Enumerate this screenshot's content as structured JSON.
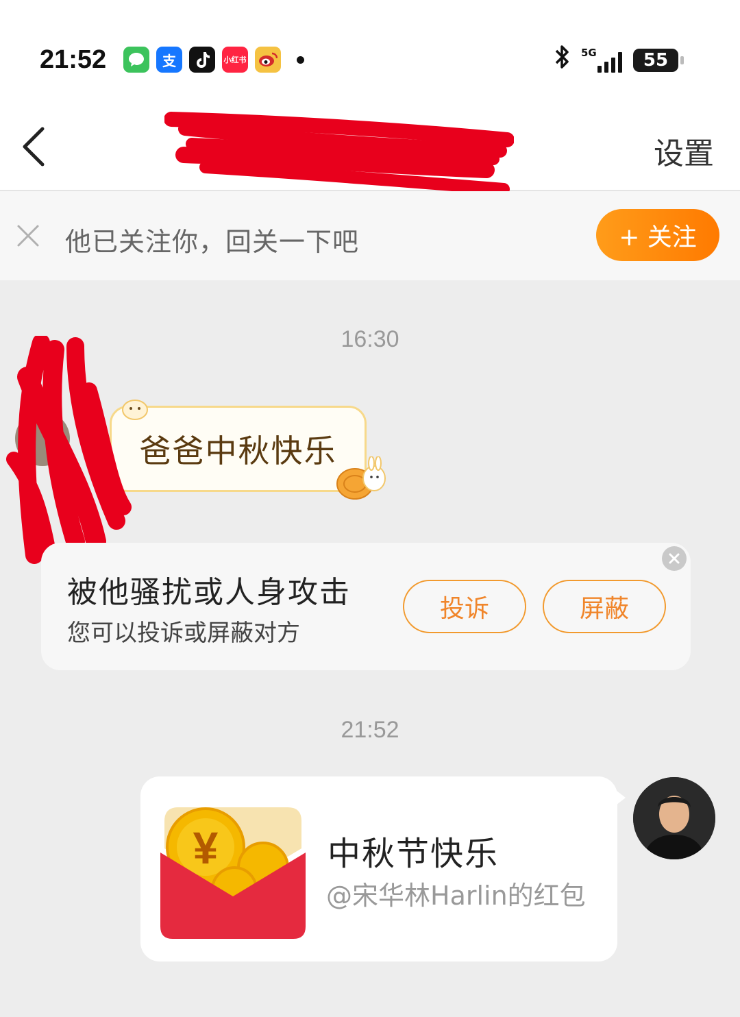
{
  "status_bar": {
    "time": "21:52",
    "network": "5G",
    "battery": "55",
    "app_icons": [
      "messages-icon",
      "alipay-icon",
      "tiktok-icon",
      "xiaohongshu-icon",
      "weibo-icon"
    ],
    "app_icon_labels": {
      "alipay": "支",
      "xiaohongshu": "小红书"
    }
  },
  "nav": {
    "settings_label": "设置"
  },
  "follow_banner": {
    "text": "他已关注你，回关一下吧",
    "button_label": "+ 关注"
  },
  "messages": [
    {
      "timestamp": "16:30",
      "text": "爸爸中秋快乐"
    },
    {
      "timestamp": "21:52",
      "title": "中秋节快乐",
      "subtitle": "@宋华林Harlin的红包"
    }
  ],
  "notice": {
    "title": "被他骚扰或人身攻击",
    "subtitle": "您可以投诉或屏蔽对方",
    "complain_label": "投诉",
    "block_label": "屏蔽"
  },
  "colors": {
    "accent_orange": "#ff8a00",
    "redaction_red": "#e8001c",
    "packet_red": "#e52a3f",
    "coin_gold": "#f5b800"
  }
}
